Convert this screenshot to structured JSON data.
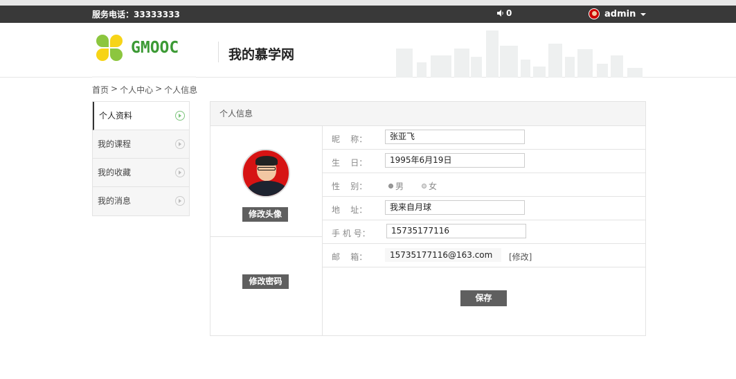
{
  "topbar": {
    "phone": "服务电话：33333333",
    "notice_count": "0",
    "username": "admin"
  },
  "header": {
    "brand": "GMOOC",
    "site_title": "我的慕学网"
  },
  "breadcrumb": [
    "首页",
    ">",
    "个人中心",
    ">",
    "个人信息"
  ],
  "sidebar": {
    "items": [
      {
        "label": "个人资料",
        "active": true
      },
      {
        "label": "我的课程",
        "active": false
      },
      {
        "label": "我的收藏",
        "active": false
      },
      {
        "label": "我的消息",
        "active": false
      }
    ]
  },
  "panel": {
    "title": "个人信息",
    "change_avatar": "修改头像",
    "change_password": "修改密码",
    "fields": {
      "nickname_label": "昵    称：",
      "nickname": "张亚飞",
      "birthday_label": "生    日：",
      "birthday": "1995年6月19日",
      "gender_label": "性    别：",
      "gender_male": "男",
      "gender_female": "女",
      "gender_selected": "男",
      "address_label": "地    址：",
      "address": "我来自月球",
      "mobile_label": "手 机 号：",
      "mobile": "15735177116",
      "email_label": "邮    箱：",
      "email": "15735177116@163.com",
      "email_modify": "[修改]"
    },
    "save_label": "保存"
  },
  "colors": {
    "topbar": "#393939",
    "brand_green": "#3c9a35",
    "brand_yellow": "#f7d417",
    "button_gray": "#5f5f5f"
  }
}
